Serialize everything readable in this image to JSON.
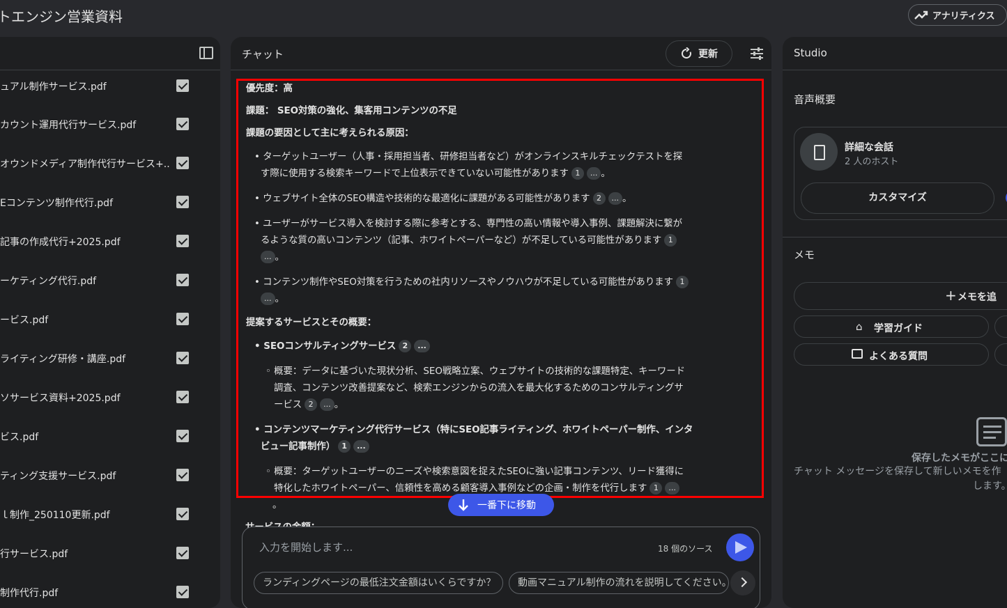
{
  "app": {
    "title": "トエンジン営業資料",
    "analytics_label": "アナリティクス"
  },
  "sources": {
    "items": [
      "ュアル制作サービス.pdf",
      "カウント運用代行サービス.pdf",
      "オウンドメディア制作代行サービス+...",
      "Eコンテンツ制作代行.pdf",
      "記事の作成代行+2025.pdf",
      "ーケティング代行.pdf",
      "ービス.pdf",
      "ライティング研修・講座.pdf",
      "ソサービス資料+2025.pdf",
      "ビス.pdf",
      "ティング支援サービス.pdf",
      "ｌ制作_250110更新.pdf",
      "行サービス.pdf",
      "制作代行.pdf"
    ]
  },
  "chat": {
    "title": "チャット",
    "refresh_label": "更新",
    "priority": "優先度：高",
    "issue": "課題： SEO対策の強化、集客用コンテンツの不足",
    "causes_heading": "課題の要因として主に考えられる原因：",
    "causes": [
      {
        "line1": "ターゲットユーザー（人事・採用担当者、研修担当者など）がオンラインスキルチェックテストを探",
        "line2": "す際に使用する検索キーワードで上位表示できていない可能性があります",
        "cite": "1",
        "more": "..."
      },
      {
        "line1": "ウェブサイト全体のSEO構造や技術的な最適化に課題がある可能性があります",
        "cite": "2",
        "more": "..."
      },
      {
        "line1": "ユーザーがサービス導入を検討する際に参考とする、専門性の高い情報や導入事例、課題解決に繋が",
        "line2": "るような質の高いコンテンツ（記事、ホワイトペーパーなど）が不足している可能性があります",
        "cite": "1",
        "more": "..."
      },
      {
        "line1": "コンテンツ制作やSEO対策を行うための社内リソースやノウハウが不足している可能性があります",
        "cite": "1",
        "more": "..."
      }
    ],
    "services_heading": "提案するサービスとその概要：",
    "services": [
      {
        "name": "SEOコンサルティングサービス",
        "cite": "2",
        "more": "...",
        "desc1": "概要：データに基づいた現状分析、SEO戦略立案、ウェブサイトの技術的な課題特定、キーワード",
        "desc2": "調査、コンテンツ改善提案など、検索エンジンからの流入を最大化するためのコンサルティングサ",
        "desc3": "ービス",
        "desc_cite": "2",
        "desc_more": "..."
      },
      {
        "name1": "コンテンツマーケティング代行サービス（特にSEO記事ライティング、ホワイトペーパー制作、インタ",
        "name2": "ビュー記事制作）",
        "cite": "1",
        "more": "...",
        "desc1": "概要：ターゲットユーザーのニーズや検索意図を捉えたSEOに強い記事コンテンツ、リード獲得に",
        "desc2": "特化したホワイトペーパー、信頼性を高める顧客導入事例などの企画・制作を代行します",
        "desc_cite": "1",
        "desc_more": "..."
      }
    ],
    "period": "。",
    "scroll_label": "一番下に移動",
    "cut_heading": "サービスの金額：",
    "input_placeholder": "入力を開始します...",
    "source_count": "18 個のソース",
    "suggestions": [
      "ランディングページの最低注文金額はいくらですか？",
      "動画マニュアル制作の流れを説明してください。"
    ]
  },
  "studio": {
    "title": "Studio",
    "audio_heading": "音声概要",
    "audio_title": "詳細な会話",
    "audio_sub": "2 人のホスト",
    "customize_label": "カスタマイズ",
    "memo_heading": "メモ",
    "add_memo_label": "メモを追",
    "study_guide_label": "学習ガイド",
    "faq_label": "よくある質問",
    "empty_title": "保存したメモがここに",
    "empty_desc": "チャット メッセージを保存して新しいメモを作",
    "empty_desc2": "します。"
  },
  "colors": {
    "accent": "#3d57e8",
    "highlight": "#ff0000",
    "panel": "#1e1f21",
    "background": "#28292d"
  }
}
